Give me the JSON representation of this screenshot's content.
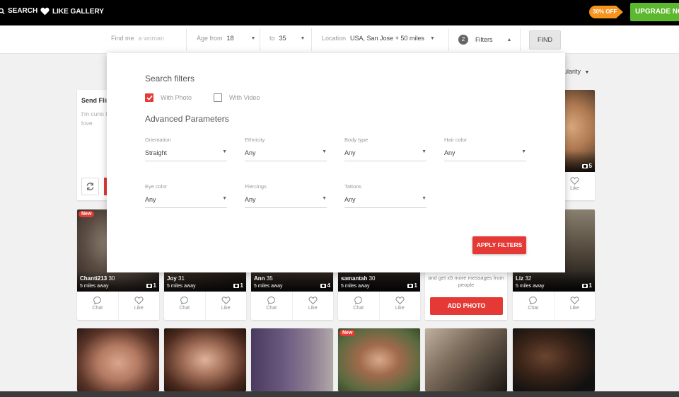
{
  "topbar": {
    "search_label": "SEARCH",
    "gallery_label": "LIKE GALLERY",
    "discount_label": "30% OFF",
    "upgrade_label": "UPGRADE NOW"
  },
  "searchbar": {
    "find_me_label": "Find me",
    "find_me_value": "a woman",
    "age_from_label": "Age from",
    "age_from_value": "18",
    "age_to_label": "to",
    "age_to_value": "35",
    "location_label": "Location",
    "location_value": "USA, San Jose + 50 miles",
    "filters_count": "2",
    "filters_label": "Filters",
    "find_button": "FIND"
  },
  "sort": {
    "label": "pularity"
  },
  "flirt_card": {
    "title": "Send Flir",
    "text": "I'm curio three thi truly love"
  },
  "filter_modal": {
    "title": "Search filters",
    "with_photo_label": "With Photo",
    "with_photo_checked": true,
    "with_video_label": "With Video",
    "with_video_checked": false,
    "advanced_title": "Advanced Parameters",
    "fields": [
      {
        "label": "Orientation",
        "value": "Straight"
      },
      {
        "label": "Ethnicity",
        "value": "Any"
      },
      {
        "label": "Body type",
        "value": "Any"
      },
      {
        "label": "Hair color",
        "value": "Any"
      },
      {
        "label": "Eye color",
        "value": "Any"
      },
      {
        "label": "Piercings",
        "value": "Any"
      },
      {
        "label": "Tattoos",
        "value": "Any"
      }
    ],
    "apply_button": "APPLY FILTERS"
  },
  "profiles_row1_top": {
    "photo_count": "5",
    "like_label": "Like"
  },
  "profiles_row2": [
    {
      "name": "Chanti213",
      "age": "30",
      "distance": "5 miles away",
      "photos": "1",
      "is_new": true,
      "new_label": "New"
    },
    {
      "name": "Joy",
      "age": "31",
      "distance": "5 miles away",
      "photos": "1"
    },
    {
      "name": "Ann",
      "age": "35",
      "distance": "5 miles away",
      "photos": "4"
    },
    {
      "name": "samantah",
      "age": "30",
      "distance": "5 miles away",
      "photos": "1"
    },
    {
      "name": "Liz",
      "age": "32",
      "distance": "5 miles away",
      "photos": "1"
    }
  ],
  "add_photo_card": {
    "text": "and get x5 more messages from people",
    "button": "ADD PHOTO"
  },
  "card_actions": {
    "chat": "Chat",
    "like": "Like"
  },
  "profiles_row3": {
    "new_label": "New"
  },
  "colors": {
    "accent_red": "#e53935",
    "upgrade_green": "#5cb82e",
    "discount_orange": "#f7941d"
  }
}
